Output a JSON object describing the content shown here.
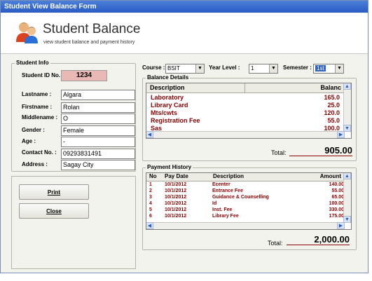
{
  "window": {
    "title": "Student View Balance Form"
  },
  "banner": {
    "title": "Student Balance",
    "subtitle": "view student balance and payment history"
  },
  "student_info": {
    "legend": "Student Info",
    "id_label": "Student ID No. :",
    "id_value": "1234",
    "fields": [
      {
        "label": "Lastname :",
        "value": "Algara"
      },
      {
        "label": "Firstname :",
        "value": "Rolan"
      },
      {
        "label": "Middlename :",
        "value": "O"
      },
      {
        "label": "Gender :",
        "value": "Female"
      },
      {
        "label": "Age :",
        "value": "-"
      },
      {
        "label": "Contact No. :",
        "value": "09293831491"
      },
      {
        "label": "Address :",
        "value": "Sagay City"
      }
    ]
  },
  "buttons": {
    "print": "Print",
    "close": "Close"
  },
  "filters": {
    "course_label": "Course :",
    "course_value": "BSIT",
    "year_label": "Year Level :",
    "year_value": "1",
    "semester_label": "Semester :",
    "semester_value": "1st"
  },
  "balance": {
    "legend": "Balance Details",
    "columns": [
      "Description",
      "Balanc"
    ],
    "rows": [
      {
        "description": "Laboratory",
        "amount": "165.0"
      },
      {
        "description": "Library Card",
        "amount": "25.0"
      },
      {
        "description": "Mts/cwts",
        "amount": "120.0"
      },
      {
        "description": "Registration Fee",
        "amount": "55.0"
      },
      {
        "description": "Sas",
        "amount": "100.0"
      }
    ],
    "total_label": "Total:",
    "total_value": "905.00"
  },
  "payments": {
    "legend": "Payment History",
    "columns": [
      "No",
      "Pay Date",
      "Description",
      "Amount"
    ],
    "rows": [
      {
        "no": "1",
        "date": "10/1/2012",
        "description": "Ecenter",
        "amount": "140.00"
      },
      {
        "no": "2",
        "date": "10/1/2012",
        "description": "Entrance Fee",
        "amount": "55.00"
      },
      {
        "no": "3",
        "date": "10/1/2012",
        "description": "Guidance & Counselling",
        "amount": "65.00"
      },
      {
        "no": "4",
        "date": "10/1/2012",
        "description": "Id",
        "amount": "100.00"
      },
      {
        "no": "5",
        "date": "10/1/2012",
        "description": "Inst. Fee",
        "amount": "330.00"
      },
      {
        "no": "6",
        "date": "10/1/2012",
        "description": "Library Fee",
        "amount": "175.00"
      }
    ],
    "total_label": "Total:",
    "total_value": "2,000.00"
  }
}
